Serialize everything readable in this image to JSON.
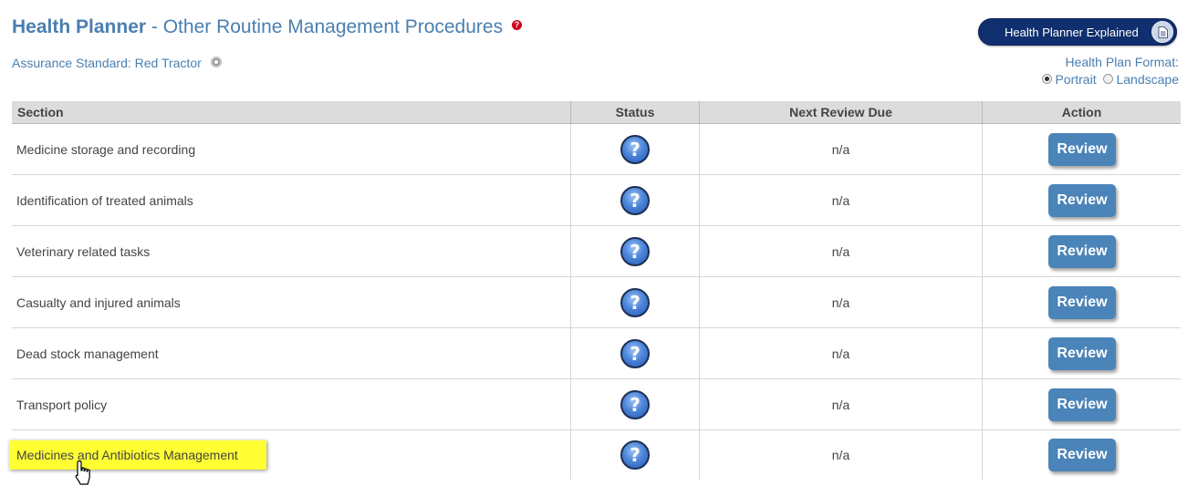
{
  "header": {
    "title_strong": "Health Planner",
    "title_rest": "- Other Routine Management Procedures",
    "standard_label": "Assurance Standard: Red Tractor"
  },
  "explained_button": {
    "label": "Health Planner Explained"
  },
  "format": {
    "label": "Health Plan Format:",
    "options": [
      "Portrait",
      "Landscape"
    ],
    "selected": "Portrait"
  },
  "table": {
    "columns": [
      "Section",
      "Status",
      "Next Review Due",
      "Action"
    ],
    "rows": [
      {
        "section": "Medicine storage and recording",
        "status_icon": "question-icon",
        "due": "n/a",
        "action": "Review"
      },
      {
        "section": "Identification of treated animals",
        "status_icon": "question-icon",
        "due": "n/a",
        "action": "Review"
      },
      {
        "section": "Veterinary related tasks",
        "status_icon": "question-icon",
        "due": "n/a",
        "action": "Review"
      },
      {
        "section": "Casualty and injured animals",
        "status_icon": "question-icon",
        "due": "n/a",
        "action": "Review"
      },
      {
        "section": "Dead stock management",
        "status_icon": "question-icon",
        "due": "n/a",
        "action": "Review"
      },
      {
        "section": "Transport policy",
        "status_icon": "question-icon",
        "due": "n/a",
        "action": "Review"
      },
      {
        "section": "Medicines and Antibiotics Management",
        "status_icon": "question-icon",
        "due": "n/a",
        "action": "Review",
        "highlighted": true
      }
    ]
  },
  "colors": {
    "title_blue": "#4a7fb0",
    "button_navy": "#0f2f6e",
    "review_blue": "#4b84b8",
    "highlight_yellow": "#ffff33",
    "help_red": "#d0021b"
  }
}
